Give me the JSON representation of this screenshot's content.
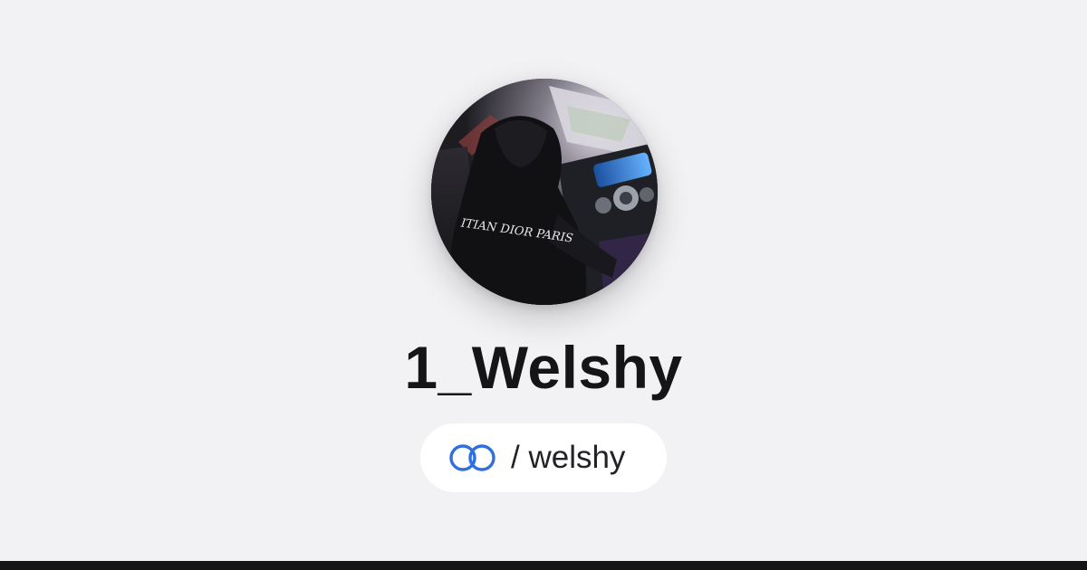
{
  "profile": {
    "display_name": "1_Welshy",
    "handle_text": "/ welshy",
    "avatar_icon": "profile-photo",
    "avatar_hoodie_text": "ITIAN DIOR PARIS"
  },
  "link_icon": "linked-rings-icon",
  "colors": {
    "background": "#f2f2f4",
    "name_text": "#151518",
    "pill_background": "#ffffff",
    "link_icon": "#2f6fe0",
    "bottom_bar": "#151518"
  }
}
